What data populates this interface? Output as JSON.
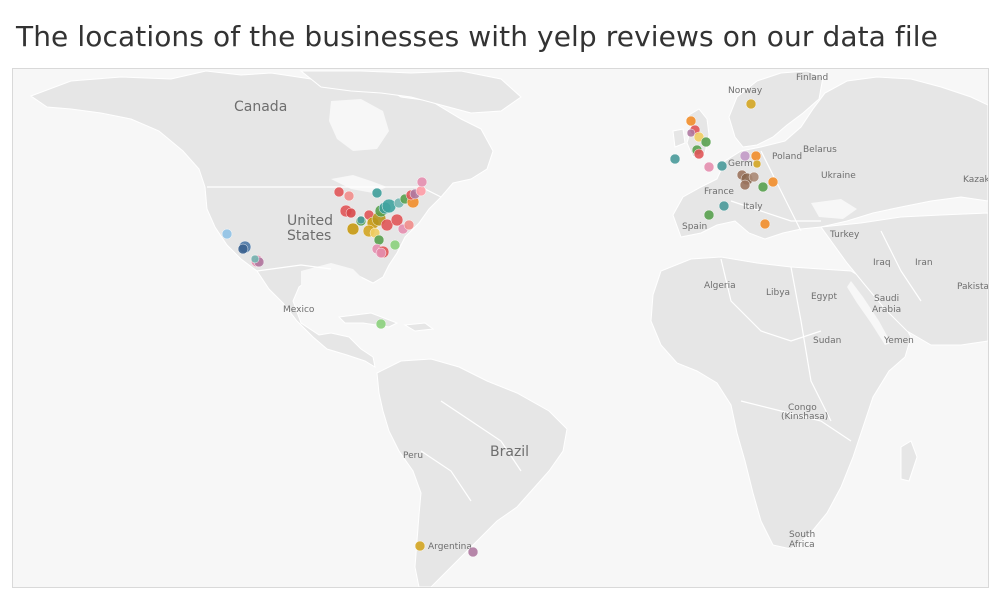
{
  "title": "The locations of the businesses with yelp reviews on our data file",
  "labels": {
    "canada": "Canada",
    "united": "United",
    "states": "States",
    "mexico": "Mexico",
    "brazil": "Brazil",
    "peru": "Peru",
    "argentina": "Argentina",
    "finland": "Finland",
    "norway": "Norway",
    "belarus": "Belarus",
    "poland": "Poland",
    "ukraine": "Ukraine",
    "kazak": "Kazak",
    "germany": "Germ",
    "france": "France",
    "italy": "Italy",
    "spain": "Spain",
    "turkey": "Turkey",
    "iraq": "Iraq",
    "iran": "Iran",
    "pakista": "Pakista",
    "algeria": "Algeria",
    "libya": "Libya",
    "egypt": "Egypt",
    "saudi": "Saudi",
    "arabia": "Arabia",
    "sudan": "Sudan",
    "yemen": "Yemen",
    "congo": "Congo",
    "kinshasa": "(Kinshasa)",
    "south": "South",
    "africa": "Africa"
  },
  "colors": {
    "land": "#e6e6e6",
    "ocean": "#f7f7f7",
    "border": "#ffffff",
    "label": "#6e6e6e",
    "title": "#333333"
  }
}
